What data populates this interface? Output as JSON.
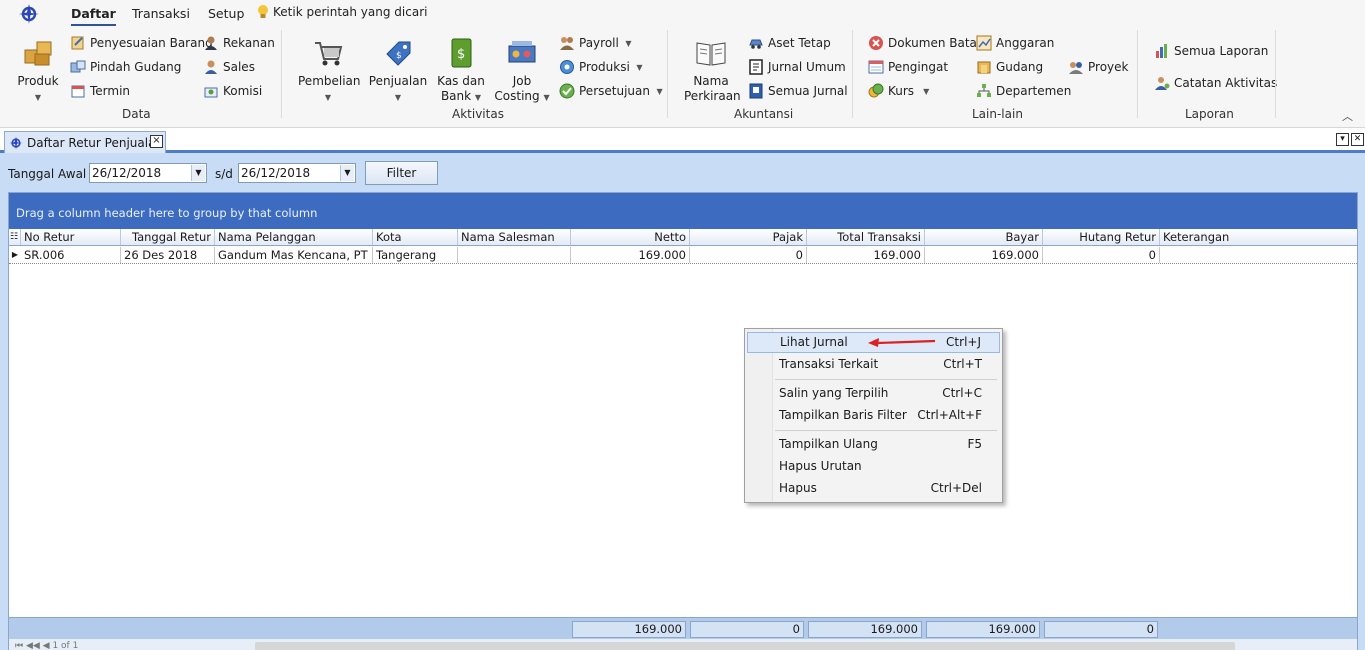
{
  "ribbon": {
    "tabs": [
      {
        "label": "Daftar",
        "active": true
      },
      {
        "label": "Transaksi",
        "active": false
      },
      {
        "label": "Setup",
        "active": false
      }
    ],
    "tell_me": "Ketik perintah yang dicari",
    "groups": {
      "data": {
        "label": "Data",
        "big": {
          "label": "Produk",
          "icon": "boxes-icon"
        },
        "items": [
          {
            "label": "Penyesuaian Barang",
            "icon": "adjust-icon"
          },
          {
            "label": "Pindah Gudang",
            "icon": "transfer-icon"
          },
          {
            "label": "Termin",
            "icon": "calendar-icon"
          },
          {
            "label": "Rekanan",
            "icon": "person-icon"
          },
          {
            "label": "Sales",
            "icon": "sales-icon"
          },
          {
            "label": "Komisi",
            "icon": "commission-icon"
          }
        ]
      },
      "aktivitas": {
        "label": "Aktivitas",
        "big": [
          {
            "label": "Pembelian",
            "icon": "cart-icon"
          },
          {
            "label": "Penjualan",
            "icon": "tag-icon"
          },
          {
            "label_line1": "Kas dan",
            "label_line2": "Bank",
            "icon": "money-icon"
          },
          {
            "label_line1": "Job",
            "label_line2": "Costing",
            "icon": "job-costing-icon"
          }
        ],
        "items": [
          {
            "label": "Payroll",
            "icon": "payroll-icon"
          },
          {
            "label": "Produksi",
            "icon": "production-icon"
          },
          {
            "label": "Persetujuan",
            "icon": "approval-icon"
          }
        ]
      },
      "akuntansi": {
        "label": "Akuntansi",
        "big": {
          "label_line1": "Nama",
          "label_line2": "Perkiraan",
          "icon": "book-icon"
        },
        "items": [
          {
            "label": "Aset Tetap",
            "icon": "car-icon"
          },
          {
            "label": "Jurnal Umum",
            "icon": "journal-icon"
          },
          {
            "label": "Semua Jurnal",
            "icon": "all-journal-icon"
          }
        ]
      },
      "lain": {
        "label": "Lain-lain",
        "items": [
          {
            "label": "Dokumen Batal",
            "icon": "cancel-doc-icon"
          },
          {
            "label": "Pengingat",
            "icon": "reminder-icon"
          },
          {
            "label": "Kurs",
            "icon": "currency-icon"
          },
          {
            "label": "Anggaran",
            "icon": "budget-icon"
          },
          {
            "label": "Gudang",
            "icon": "warehouse-icon"
          },
          {
            "label": "Departemen",
            "icon": "department-icon"
          },
          {
            "label": "Proyek",
            "icon": "project-icon"
          }
        ]
      },
      "laporan": {
        "label": "Laporan",
        "items": [
          {
            "label": "Semua Laporan",
            "icon": "report-icon"
          },
          {
            "label": "Catatan Aktivitas",
            "icon": "activity-log-icon"
          }
        ]
      }
    }
  },
  "doc_tab": {
    "title": "Daftar Retur Penjualan",
    "close": "×"
  },
  "filter": {
    "start_label": "Tanggal Awal",
    "start_value": "26/12/2018",
    "sep_label": "s/d",
    "end_value": "26/12/2018",
    "button": "Filter"
  },
  "grid": {
    "group_hint": "Drag a column header here to group by that column",
    "columns": [
      "No Retur",
      "Tanggal Retur",
      "Nama Pelanggan",
      "Kota",
      "Nama Salesman",
      "Netto",
      "Pajak",
      "Total Transaksi",
      "Bayar",
      "Hutang Retur",
      "Keterangan"
    ],
    "rows": [
      [
        "SR.006",
        "26 Des 2018",
        "Gandum Mas Kencana, PT",
        "Tangerang",
        "",
        "169.000",
        "0",
        "169.000",
        "169.000",
        "0",
        ""
      ]
    ],
    "totals": {
      "netto": "169.000",
      "pajak": "0",
      "total": "169.000",
      "bayar": "169.000",
      "hutang": "0"
    },
    "navigator": "1 of 1"
  },
  "context_menu": {
    "items": [
      {
        "label": "Lihat Jurnal",
        "shortcut": "Ctrl+J"
      },
      {
        "label": "Transaksi Terkait",
        "shortcut": "Ctrl+T"
      },
      {
        "label": "Salin yang Terpilih",
        "shortcut": "Ctrl+C"
      },
      {
        "label": "Tampilkan Baris Filter",
        "shortcut": "Ctrl+Alt+F"
      },
      {
        "label": "Tampilkan Ulang",
        "shortcut": "F5"
      },
      {
        "label": "Hapus Urutan",
        "shortcut": ""
      },
      {
        "label": "Hapus",
        "shortcut": "Ctrl+Del"
      }
    ]
  },
  "colors": {
    "accent": "#3d6bbf",
    "highlight": "#dde9f8",
    "arrow": "#e02020"
  }
}
